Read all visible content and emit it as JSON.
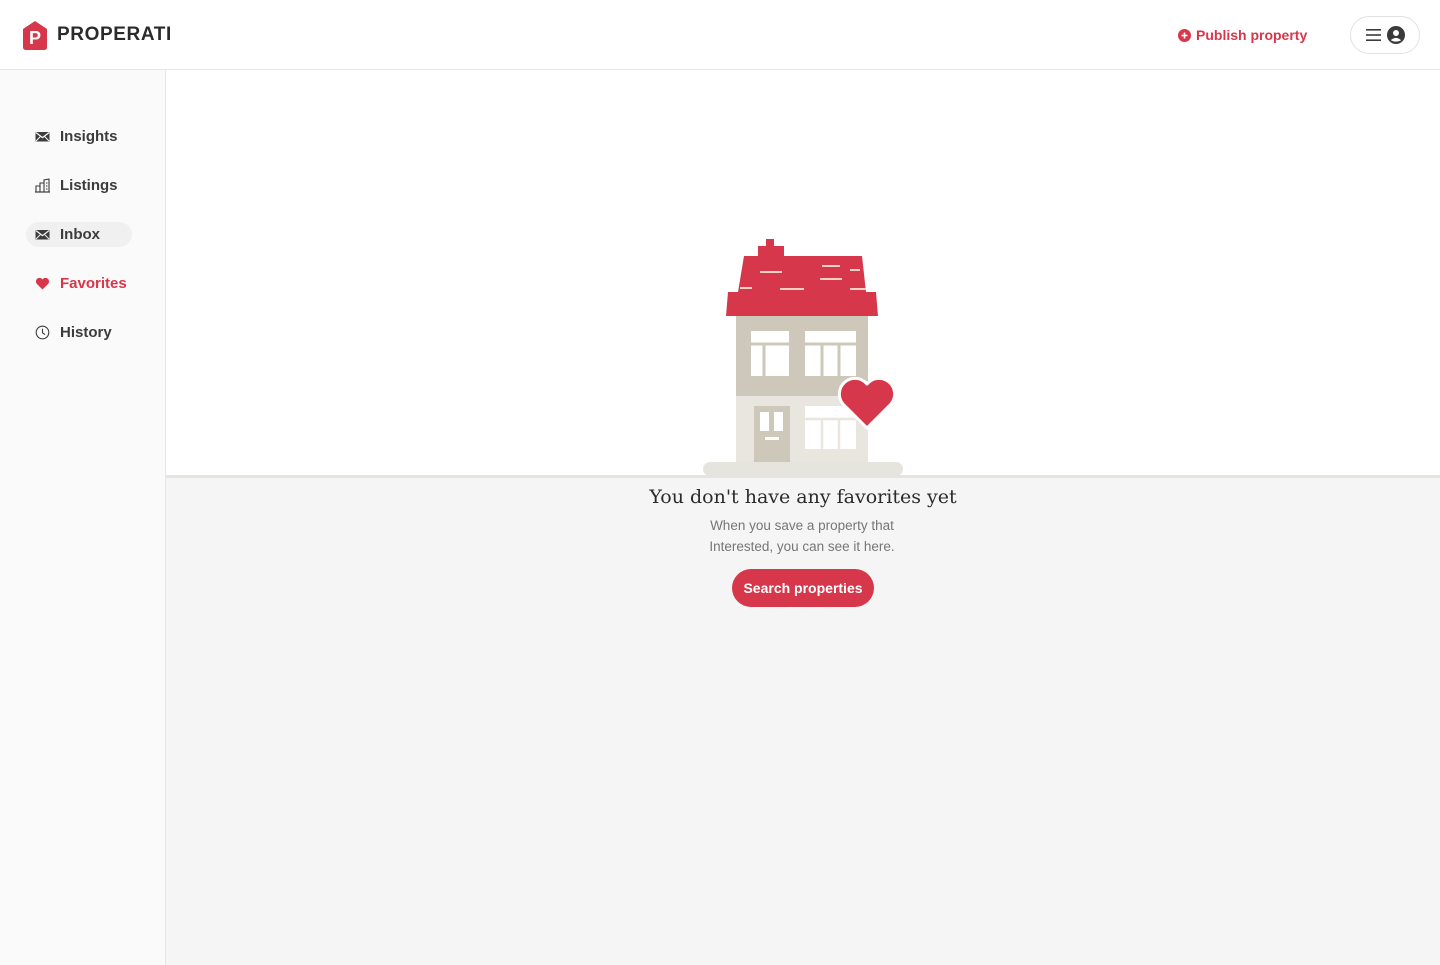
{
  "brand": {
    "name": "PROPERATI",
    "logo_letter": "P",
    "color": "#d7374a"
  },
  "header": {
    "publish_label": "Publish property",
    "publish_icon": "plus-circle-icon",
    "menu_icon": "hamburger-icon",
    "avatar_icon": "user-avatar-icon"
  },
  "sidebar": {
    "items": [
      {
        "label": "Insights",
        "icon": "envelope-icon",
        "active": false
      },
      {
        "label": "Listings",
        "icon": "buildings-icon",
        "active": false
      },
      {
        "label": "Inbox",
        "icon": "envelope-icon",
        "active": false,
        "hovered": true
      },
      {
        "label": "Favorites",
        "icon": "heart-icon",
        "active": true
      },
      {
        "label": "History",
        "icon": "clock-icon",
        "active": false
      }
    ]
  },
  "empty_state": {
    "title": "You don't have any favorites yet",
    "line1": "When you save a property that",
    "line2": "Interested, you can see it here.",
    "button_label": "Search properties",
    "illustration": "house-with-heart-illustration"
  }
}
